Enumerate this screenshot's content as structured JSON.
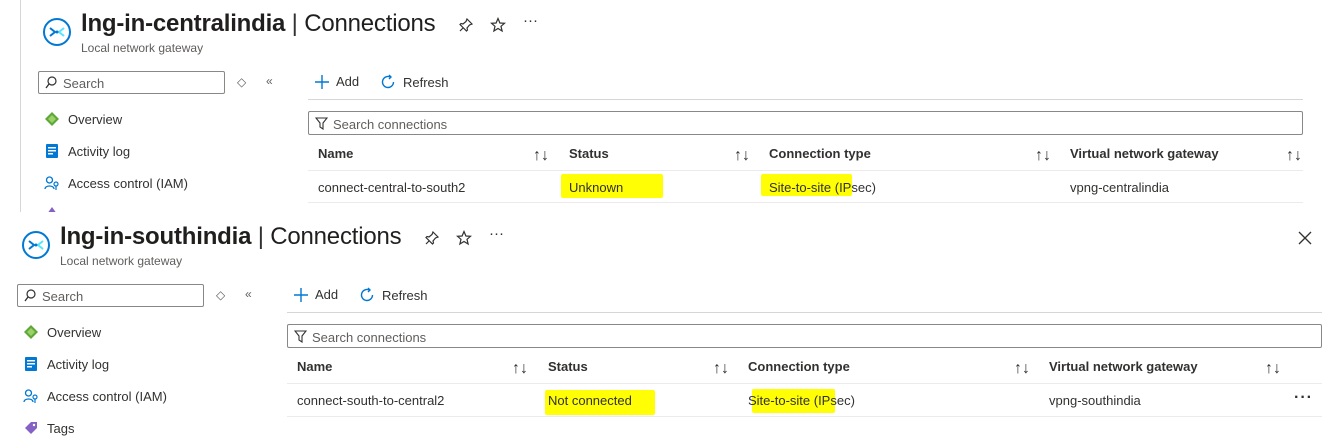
{
  "panels": [
    {
      "resource_name": "lng-in-centralindia",
      "separator": " | ",
      "blade_title": "Connections",
      "subtitle": "Local network gateway",
      "search_placeholder": "Search",
      "nav": [
        {
          "label": "Overview",
          "icon": "overview-icon"
        },
        {
          "label": "Activity log",
          "icon": "activity-log-icon"
        },
        {
          "label": "Access control (IAM)",
          "icon": "iam-icon"
        }
      ],
      "commands": {
        "add": "Add",
        "refresh": "Refresh"
      },
      "filter_placeholder": "Search connections",
      "columns": [
        "Name",
        "Status",
        "Connection type",
        "Virtual network gateway"
      ],
      "rows": [
        {
          "name": "connect-central-to-south2",
          "status": "Unknown",
          "connection_type": "Site-to-site (IPsec)",
          "gateway": "vpng-centralindia"
        }
      ]
    },
    {
      "resource_name": "lng-in-southindia",
      "separator": " | ",
      "blade_title": "Connections",
      "subtitle": "Local network gateway",
      "search_placeholder": "Search",
      "nav": [
        {
          "label": "Overview",
          "icon": "overview-icon"
        },
        {
          "label": "Activity log",
          "icon": "activity-log-icon"
        },
        {
          "label": "Access control (IAM)",
          "icon": "iam-icon"
        },
        {
          "label": "Tags",
          "icon": "tag-icon"
        }
      ],
      "commands": {
        "add": "Add",
        "refresh": "Refresh"
      },
      "filter_placeholder": "Search connections",
      "columns": [
        "Name",
        "Status",
        "Connection type",
        "Virtual network gateway"
      ],
      "rows": [
        {
          "name": "connect-south-to-central2",
          "status": "Not connected",
          "connection_type": "Site-to-site (IPsec)",
          "gateway": "vpng-southindia"
        }
      ]
    }
  ],
  "colors": {
    "accent": "#0078d4",
    "highlight": "#fffe05",
    "text": "#323130",
    "muted": "#605e5c"
  }
}
